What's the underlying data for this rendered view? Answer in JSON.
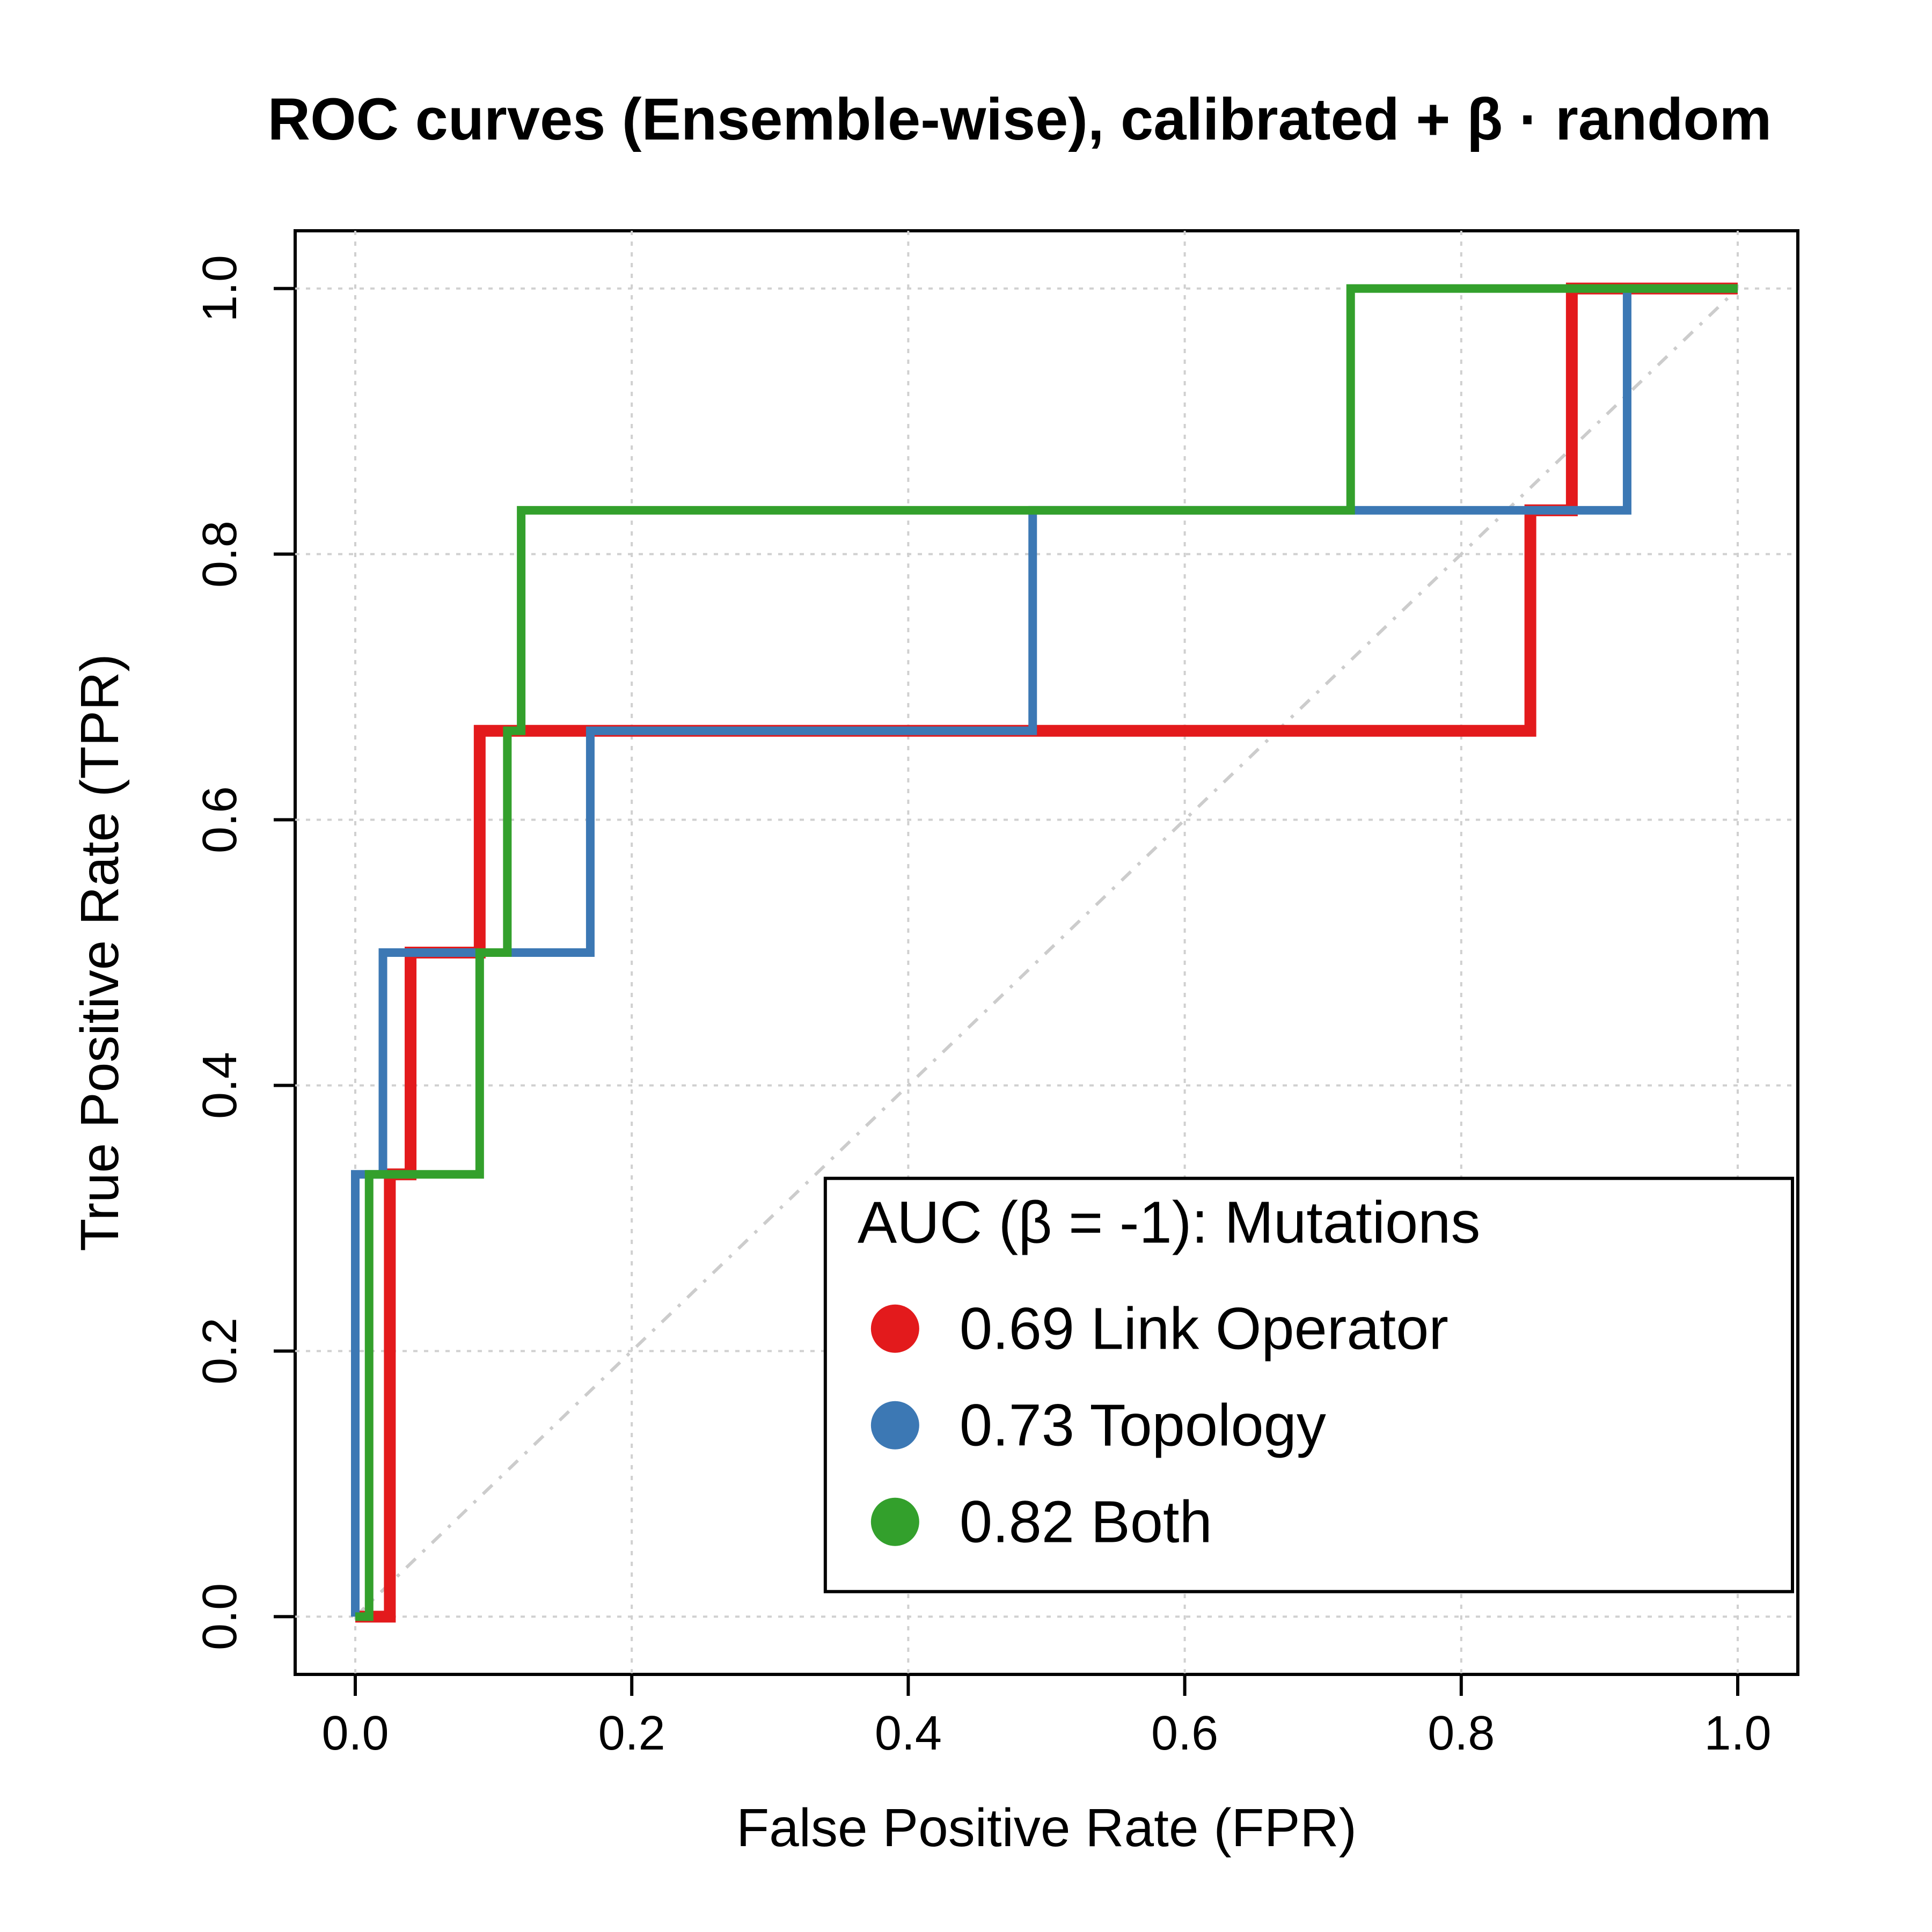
{
  "chart_data": {
    "type": "line",
    "title": "ROC curves (Ensemble-wise), calibrated + β · random",
    "xlabel": "False Positive Rate (FPR)",
    "ylabel": "True Positive Rate (TPR)",
    "xlim": [
      0,
      1
    ],
    "ylim": [
      0,
      1
    ],
    "x_ticks": [
      0.0,
      0.2,
      0.4,
      0.6,
      0.8,
      1.0
    ],
    "y_ticks": [
      0.0,
      0.2,
      0.4,
      0.6,
      0.8,
      1.0
    ],
    "grid": true,
    "diagonal_reference": true,
    "legend": {
      "title": "AUC (β = -1): Mutations",
      "position": "bottom-right",
      "entries": [
        {
          "color": "#E31A1C",
          "auc": 0.69,
          "name": "Link Operator",
          "label": "0.69 Link Operator"
        },
        {
          "color": "#3C78B4",
          "auc": 0.73,
          "name": "Topology",
          "label": "0.73 Topology"
        },
        {
          "color": "#33A02C",
          "auc": 0.82,
          "name": "Both",
          "label": "0.82 Both"
        }
      ]
    },
    "series": [
      {
        "name": "Link Operator",
        "color": "#E31A1C",
        "linewidth": 22,
        "x": [
          0.0,
          0.025,
          0.025,
          0.04,
          0.04,
          0.09,
          0.09,
          0.85,
          0.85,
          0.88,
          0.88,
          1.0
        ],
        "y": [
          0.0,
          0.0,
          0.333,
          0.333,
          0.5,
          0.5,
          0.667,
          0.667,
          0.833,
          0.833,
          1.0,
          1.0
        ]
      },
      {
        "name": "Topology",
        "color": "#3C78B4",
        "linewidth": 16,
        "x": [
          0.0,
          0.0,
          0.02,
          0.02,
          0.17,
          0.17,
          0.49,
          0.49,
          0.74,
          0.74,
          0.92,
          0.92,
          1.0
        ],
        "y": [
          0.0,
          0.333,
          0.333,
          0.5,
          0.5,
          0.667,
          0.667,
          0.833,
          0.833,
          0.833,
          0.833,
          1.0,
          1.0
        ]
      },
      {
        "name": "Both",
        "color": "#33A02C",
        "linewidth": 16,
        "x": [
          0.0,
          0.01,
          0.01,
          0.09,
          0.09,
          0.11,
          0.11,
          0.12,
          0.12,
          0.72,
          0.72,
          1.0
        ],
        "y": [
          0.0,
          0.0,
          0.333,
          0.333,
          0.5,
          0.5,
          0.667,
          0.667,
          0.833,
          0.833,
          1.0,
          1.0
        ]
      }
    ]
  }
}
